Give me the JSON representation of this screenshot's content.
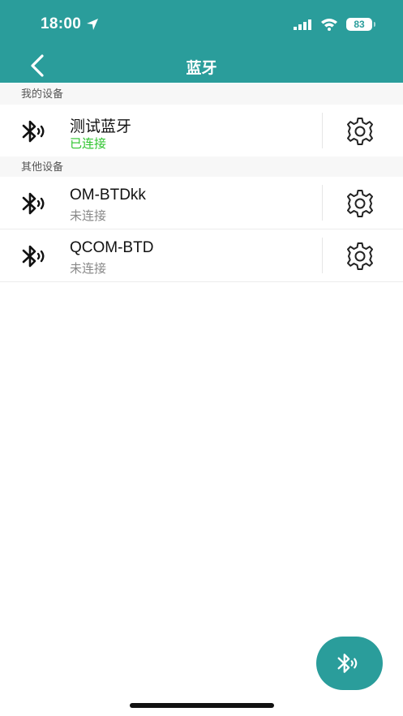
{
  "status_bar": {
    "time": "18:00",
    "battery": "83"
  },
  "nav": {
    "title": "蓝牙"
  },
  "sections": {
    "my_devices": {
      "title": "我的设备",
      "devices": [
        {
          "name": "测试蓝牙",
          "status": "已连接"
        }
      ]
    },
    "other_devices": {
      "title": "其他设备",
      "devices": [
        {
          "name": "OM-BTDkk",
          "status": "未连接"
        },
        {
          "name": "QCOM-BTD",
          "status": "未连接"
        }
      ]
    }
  },
  "icons": {
    "device": "bluetooth-icon",
    "settings": "gear-icon",
    "back": "chevron-left-icon",
    "fab": "bluetooth-icon"
  },
  "colors": {
    "accent": "#2a9d9b",
    "connected": "#2ec42e",
    "disconnected": "#888888"
  }
}
